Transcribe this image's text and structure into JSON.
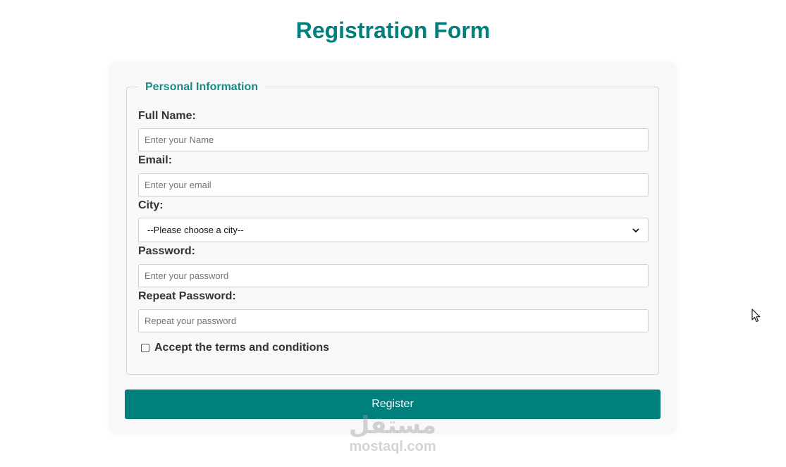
{
  "header": {
    "title": "Registration Form"
  },
  "personal_info": {
    "legend": "Personal Information",
    "full_name": {
      "label": "Full Name:",
      "placeholder": "Enter your Name",
      "value": ""
    },
    "email": {
      "label": "Email:",
      "placeholder": "Enter your email",
      "value": ""
    },
    "city": {
      "label": "City:",
      "selected": "--Please choose a city--"
    },
    "password": {
      "label": "Password:",
      "placeholder": "Enter your password",
      "value": ""
    },
    "repeat_password": {
      "label": "Repeat Password:",
      "placeholder": "Repeat your password",
      "value": ""
    },
    "terms": {
      "label": "Accept the terms and conditions",
      "checked": false
    }
  },
  "actions": {
    "register_label": "Register"
  },
  "watermark": {
    "arabic": "مستقل",
    "latin": "mostaql.com"
  },
  "colors": {
    "accent": "#00807d",
    "legend": "#1a8a86",
    "card_bg": "#f8f8f8"
  },
  "icons": {
    "select_arrow": "chevron-down-icon",
    "cursor": "mouse-pointer-icon"
  }
}
